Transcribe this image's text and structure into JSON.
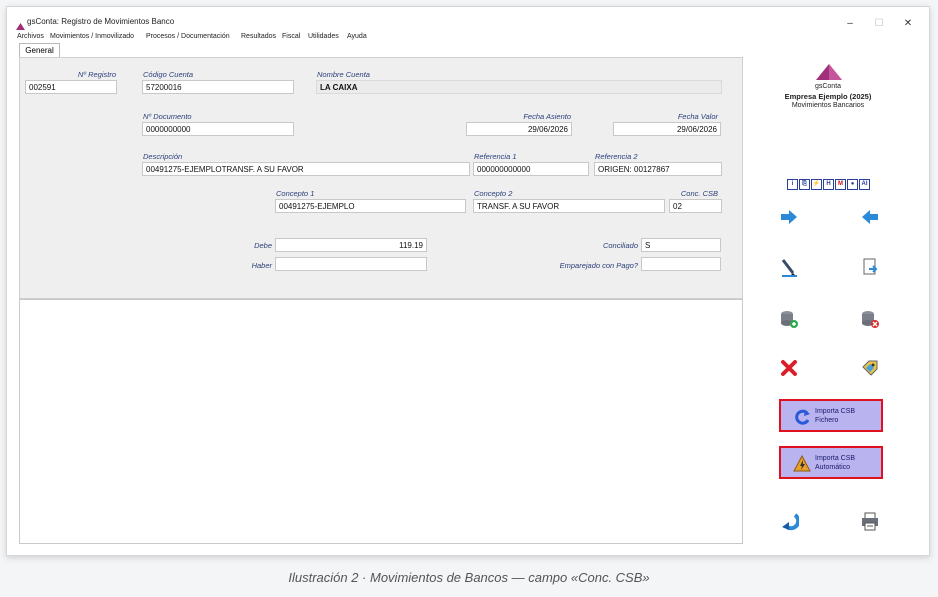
{
  "window": {
    "title": "gsConta: Registro de Movimientos Banco",
    "controls": {
      "minimize": "–",
      "maximize": "☐",
      "close": "✕"
    }
  },
  "menu": [
    "Archivos",
    "Movimientos / Inmovilizado",
    "Procesos / Documentación",
    "Resultados",
    "Fiscal",
    "Utilidades",
    "Ayuda"
  ],
  "tab": {
    "label": "General"
  },
  "form": {
    "n_registro": {
      "label": "Nº Registro",
      "value": "002591"
    },
    "codigo_cuenta": {
      "label": "Código Cuenta",
      "value": "57200016"
    },
    "nombre_cuenta": {
      "label": "Nombre Cuenta",
      "value": "LA CAIXA"
    },
    "n_documento": {
      "label": "Nº Documento",
      "value": "0000000000"
    },
    "fecha_asiento": {
      "label": "Fecha Asiento",
      "value": "29/06/2026"
    },
    "fecha_valor": {
      "label": "Fecha Valor",
      "value": "29/06/2026"
    },
    "descripcion": {
      "label": "Descripción",
      "value": "00491275-EJEMPLOTRANSF. A SU FAVOR"
    },
    "referencia1": {
      "label": "Referencia 1",
      "value": "000000000000"
    },
    "referencia2": {
      "label": "Referencia 2",
      "value": "ORIGEN: 00127867"
    },
    "concepto1": {
      "label": "Concepto 1",
      "value": "00491275-EJEMPLO"
    },
    "concepto2": {
      "label": "Concepto 2",
      "value": "TRANSF. A SU FAVOR"
    },
    "conc_csb": {
      "label": "Conc. CSB",
      "value": "02"
    },
    "debe": {
      "label": "Debe",
      "value": "119.19"
    },
    "haber": {
      "label": "Haber",
      "value": ""
    },
    "conciliado": {
      "label": "Conciliado",
      "value": "S"
    },
    "emparejado": {
      "label": "Emparejado con Pago?",
      "value": ""
    }
  },
  "side": {
    "app_name": "gsConta",
    "company": "Empresa Ejemplo (2025)",
    "module": "Movimientos Bancarios",
    "mini_buttons": [
      "i",
      "⎘",
      "⚡",
      "H",
      "M",
      "●",
      "AI"
    ],
    "import_file": {
      "line1": "Importa CSB",
      "line2": "Fichero"
    },
    "import_auto": {
      "line1": "Importa CSB",
      "line2": "Automático"
    },
    "accent_color": "#e0101e",
    "button_bg": "#b9b3ef"
  },
  "caption": "Ilustración 2 · Movimientos de Bancos — campo «Conc. CSB»"
}
